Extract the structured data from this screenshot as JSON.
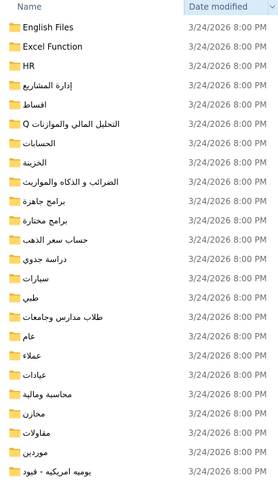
{
  "header": {
    "name_label": "Name",
    "date_label": "Date modified"
  },
  "colors": {
    "folder_body": "#ffd766",
    "folder_tab": "#e6b433",
    "header_active_bg": "#d9ebf9",
    "date_text": "#6d6d6d"
  },
  "files": [
    {
      "name": "English Files",
      "date": "3/24/2026 8:00 PM",
      "icon": "folder-icon"
    },
    {
      "name": "Excel Function",
      "date": "3/24/2026 8:00 PM",
      "icon": "folder-icon"
    },
    {
      "name": "HR",
      "date": "3/24/2026 8:00 PM",
      "icon": "folder-icon"
    },
    {
      "name": "إدارة المشاريع",
      "date": "3/24/2026 8:00 PM",
      "icon": "folder-icon"
    },
    {
      "name": "اقساط",
      "date": "3/24/2026 8:00 PM",
      "icon": "folder-icon"
    },
    {
      "name": "Q التحليل المالي والموازنات",
      "date": "3/24/2026 8:00 PM",
      "icon": "folder-icon"
    },
    {
      "name": "الحسابات",
      "date": "3/24/2026 8:00 PM",
      "icon": "folder-icon"
    },
    {
      "name": "الخزينة",
      "date": "3/24/2026 8:00 PM",
      "icon": "folder-icon"
    },
    {
      "name": "الضرائب و الذكاه والمواريث",
      "date": "3/24/2026 8:00 PM",
      "icon": "folder-icon"
    },
    {
      "name": "برامج جاهزة",
      "date": "3/24/2026 8:00 PM",
      "icon": "folder-icon"
    },
    {
      "name": "برامج مختارة",
      "date": "3/24/2026 8:00 PM",
      "icon": "folder-icon"
    },
    {
      "name": "حساب سعر الذهب",
      "date": "3/24/2026 8:00 PM",
      "icon": "folder-icon"
    },
    {
      "name": "دراسة جدوي",
      "date": "3/24/2026 8:00 PM",
      "icon": "folder-icon"
    },
    {
      "name": "سيارات",
      "date": "3/24/2026 8:00 PM",
      "icon": "folder-icon"
    },
    {
      "name": "طبي",
      "date": "3/24/2026 8:00 PM",
      "icon": "folder-icon"
    },
    {
      "name": "طلاب مدارس وجامعات",
      "date": "3/24/2026 8:00 PM",
      "icon": "folder-icon"
    },
    {
      "name": "عام",
      "date": "3/24/2026 8:00 PM",
      "icon": "folder-icon"
    },
    {
      "name": "عملاء",
      "date": "3/24/2026 8:00 PM",
      "icon": "folder-icon"
    },
    {
      "name": "عيادات",
      "date": "3/24/2026 8:00 PM",
      "icon": "folder-icon"
    },
    {
      "name": "محاسبة ومالية",
      "date": "3/24/2026 8:00 PM",
      "icon": "folder-icon"
    },
    {
      "name": "مخازن",
      "date": "3/24/2026 8:00 PM",
      "icon": "folder-icon"
    },
    {
      "name": "مقاولات",
      "date": "3/24/2026 8:00 PM",
      "icon": "folder-icon"
    },
    {
      "name": "موردين",
      "date": "3/24/2026 8:00 PM",
      "icon": "folder-icon"
    },
    {
      "name": "يوميه امريكيه - قيود",
      "date": "3/24/2026 8:00 PM",
      "icon": "folder-icon"
    }
  ]
}
